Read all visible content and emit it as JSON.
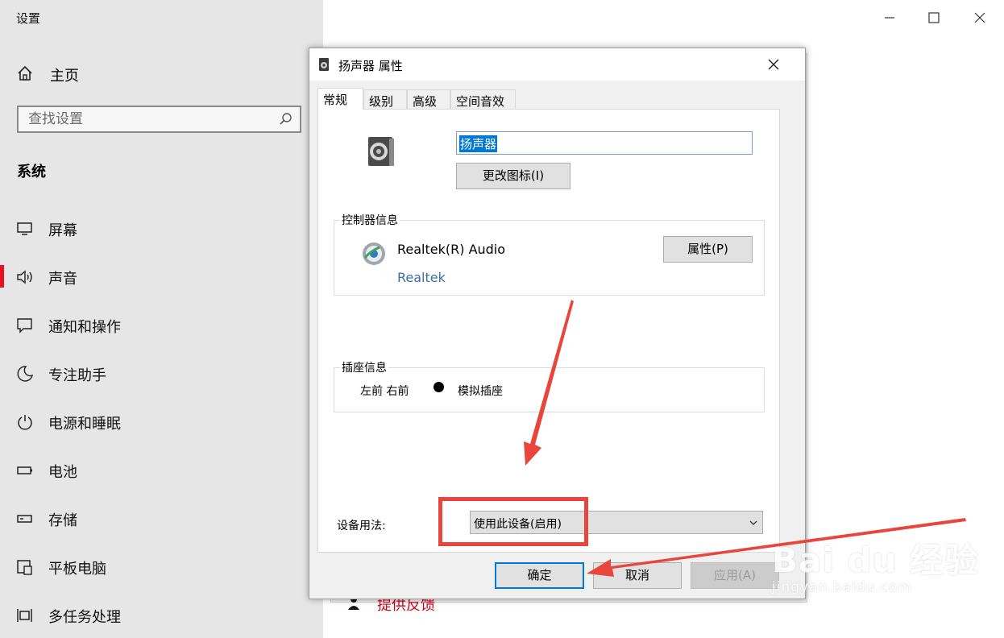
{
  "settings": {
    "app_title": "设置",
    "home_label": "主页",
    "search_placeholder": "查找设置",
    "section_title": "系统",
    "nav_items": [
      {
        "label": "屏幕",
        "icon": "monitor-icon"
      },
      {
        "label": "声音",
        "icon": "speaker-icon",
        "active": true
      },
      {
        "label": "通知和操作",
        "icon": "notification-icon"
      },
      {
        "label": "专注助手",
        "icon": "moon-icon"
      },
      {
        "label": "电源和睡眠",
        "icon": "power-icon"
      },
      {
        "label": "电池",
        "icon": "battery-icon"
      },
      {
        "label": "存储",
        "icon": "storage-icon"
      },
      {
        "label": "平板电脑",
        "icon": "tablet-icon"
      },
      {
        "label": "多任务处理",
        "icon": "multitask-icon"
      }
    ],
    "feedback_label": "提供反馈",
    "active_color": "#e81123"
  },
  "dialog": {
    "title": "扬声器 属性",
    "tabs": [
      "常规",
      "级别",
      "高级",
      "空间音效"
    ],
    "selected_tab": "常规",
    "device_name": "扬声器",
    "change_icon_button": "更改图标(I)",
    "controller_group_label": "控制器信息",
    "controller_name": "Realtek(R) Audio",
    "controller_link": "Realtek",
    "properties_button": "属性(P)",
    "jack_group_label": "插座信息",
    "jack_positions": "左前 右前",
    "jack_type": "模拟插座",
    "usage_label": "设备用法:",
    "usage_value": "使用此设备(启用)",
    "ok_button": "确定",
    "cancel_button": "取消",
    "apply_button": "应用(A)"
  },
  "watermark": {
    "brand": "Bai du 经验",
    "url": "jingyan.baidu.com"
  },
  "annotation_color": "#e8453c"
}
